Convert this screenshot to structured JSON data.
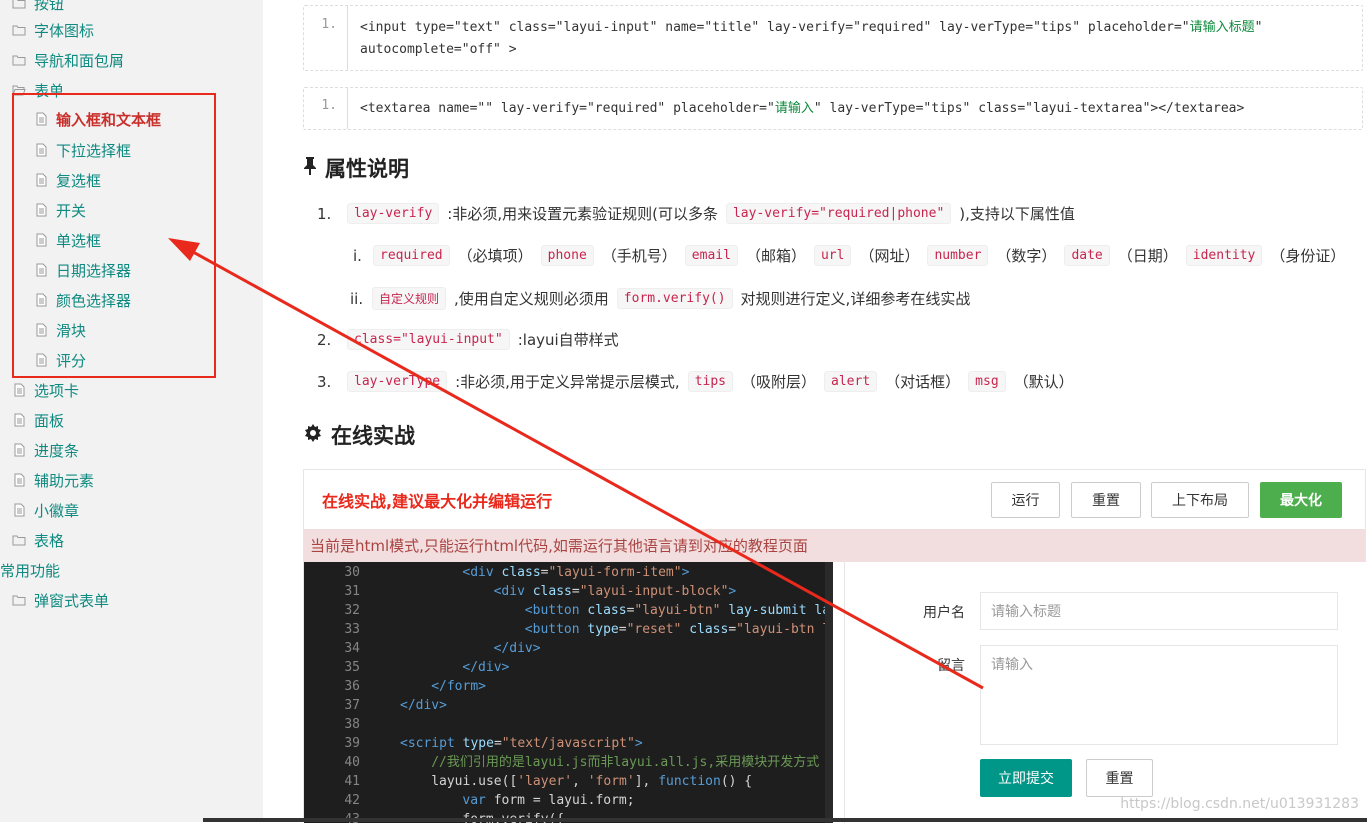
{
  "sidebar": {
    "top_partial_label": "按钮",
    "items": [
      {
        "label": "字体图标",
        "icon": "folder-icon"
      },
      {
        "label": "导航和面包屑",
        "icon": "folder-icon"
      },
      {
        "label": "表单",
        "icon": "folder-open-icon"
      },
      {
        "label": "输入框和文本框",
        "icon": "file-icon",
        "active": true
      },
      {
        "label": "下拉选择框",
        "icon": "file-icon"
      },
      {
        "label": "复选框",
        "icon": "file-icon"
      },
      {
        "label": "开关",
        "icon": "file-icon"
      },
      {
        "label": "单选框",
        "icon": "file-icon"
      },
      {
        "label": "日期选择器",
        "icon": "file-icon"
      },
      {
        "label": "颜色选择器",
        "icon": "file-icon"
      },
      {
        "label": "滑块",
        "icon": "file-icon"
      },
      {
        "label": "评分",
        "icon": "file-icon"
      },
      {
        "label": "选项卡",
        "icon": "file-icon"
      },
      {
        "label": "面板",
        "icon": "file-icon"
      },
      {
        "label": "进度条",
        "icon": "file-icon"
      },
      {
        "label": "辅助元素",
        "icon": "file-icon"
      },
      {
        "label": "小徽章",
        "icon": "file-icon"
      },
      {
        "label": "表格",
        "icon": "folder-icon"
      },
      {
        "label": "常用功能",
        "icon": "folder-icon"
      },
      {
        "label": "弹窗式表单",
        "icon": "folder-icon"
      }
    ]
  },
  "snippets": {
    "input": {
      "line_no": "1.",
      "line1_a": "<input type=\"text\" class=\"layui-input\" name=\"title\" lay-verify=\"required\" lay-verType=\"tips\" placeholder=\"",
      "line1_b": "请输入标题",
      "line1_c": "\"",
      "line2": "autocomplete=\"off\" >"
    },
    "textarea": {
      "line_no": "1.",
      "a": "<textarea name=\"\"  lay-verify=\"required\" placeholder=\"",
      "b": "请输入",
      "c": "\"  lay-verType=\"tips\" class=\"layui-textarea\"></textarea>"
    }
  },
  "attr_section": {
    "title": "属性说明",
    "icon": "pushpin-icon",
    "item1": {
      "num": "1.",
      "chip": "lay-verify",
      "text_a": ":非必须,用来设置元素验证规则(可以多条",
      "chip2": "lay-verify=\"required|phone\"",
      "text_b": "),支持以下属性值"
    },
    "sub_i": {
      "num": "i.",
      "pairs": [
        {
          "chip": "required",
          "text": "（必填项）"
        },
        {
          "chip": "phone",
          "text": "（手机号）"
        },
        {
          "chip": "email",
          "text": "（邮箱）"
        },
        {
          "chip": "url",
          "text": "（网址）"
        },
        {
          "chip": "number",
          "text": "（数字）"
        },
        {
          "chip": "date",
          "text": "（日期）"
        },
        {
          "chip": "identity",
          "text": "（身份证）"
        }
      ]
    },
    "sub_ii": {
      "num": "ii.",
      "chip": "自定义规则",
      "text_a": ",使用自定义规则必须用",
      "chip2": "form.verify()",
      "text_b": "对规则进行定义,详细参考在线实战"
    },
    "item2": {
      "num": "2.",
      "chip": "class=\"layui-input\"",
      "text": ":layui自带样式"
    },
    "item3": {
      "num": "3.",
      "chip": "lay-verType",
      "text_a": ":非必须,用于定义异常提示层模式,",
      "pairs": [
        {
          "chip": "tips",
          "text": "（吸附层）"
        },
        {
          "chip": "alert",
          "text": "（对话框）"
        },
        {
          "chip": "msg",
          "text": "（默认）"
        }
      ]
    }
  },
  "online_section": {
    "title": "在线实战",
    "icon": "gear-icon"
  },
  "demo": {
    "title": "在线实战,建议最大化并编辑运行",
    "buttons": {
      "run": "运行",
      "reset": "重置",
      "layout": "上下布局",
      "maximize": "最大化"
    },
    "notice": "当前是html模式,只能运行html代码,如需运行其他语言请到对应的教程页面",
    "code_lines": [
      {
        "no": "30",
        "indent": 8,
        "parts": [
          [
            "tag",
            "<div "
          ],
          [
            "attr",
            "class"
          ],
          [
            "plain",
            "="
          ],
          [
            "str",
            "\"layui-form-item\""
          ],
          [
            "tag",
            ">"
          ]
        ]
      },
      {
        "no": "31",
        "indent": 12,
        "parts": [
          [
            "tag",
            "<div "
          ],
          [
            "attr",
            "class"
          ],
          [
            "plain",
            "="
          ],
          [
            "str",
            "\"layui-input-block\""
          ],
          [
            "tag",
            ">"
          ]
        ]
      },
      {
        "no": "32",
        "indent": 16,
        "parts": [
          [
            "tag",
            "<button "
          ],
          [
            "attr",
            "class"
          ],
          [
            "plain",
            "="
          ],
          [
            "str",
            "\"layui-btn\""
          ],
          [
            "plain",
            " "
          ],
          [
            "attr",
            "lay-submit lay"
          ]
        ]
      },
      {
        "no": "33",
        "indent": 16,
        "parts": [
          [
            "tag",
            "<button "
          ],
          [
            "attr",
            "type"
          ],
          [
            "plain",
            "="
          ],
          [
            "str",
            "\"reset\""
          ],
          [
            "plain",
            " "
          ],
          [
            "attr",
            "class"
          ],
          [
            "plain",
            "="
          ],
          [
            "str",
            "\"layui-btn la"
          ]
        ]
      },
      {
        "no": "34",
        "indent": 12,
        "parts": [
          [
            "tag",
            "</div>"
          ]
        ]
      },
      {
        "no": "35",
        "indent": 8,
        "parts": [
          [
            "tag",
            "</div>"
          ]
        ]
      },
      {
        "no": "36",
        "indent": 4,
        "parts": [
          [
            "tag",
            "</form>"
          ]
        ]
      },
      {
        "no": "37",
        "indent": 0,
        "parts": [
          [
            "tag",
            "</div>"
          ]
        ]
      },
      {
        "no": "38",
        "indent": 0,
        "parts": []
      },
      {
        "no": "39",
        "indent": 0,
        "parts": [
          [
            "tag",
            "<script "
          ],
          [
            "attr",
            "type"
          ],
          [
            "plain",
            "="
          ],
          [
            "str",
            "\"text/javascript\""
          ],
          [
            "tag",
            ">"
          ]
        ]
      },
      {
        "no": "40",
        "indent": 4,
        "parts": [
          [
            "cmt",
            "//我们引用的是layui.js而非layui.all.js,采用模块开发方式"
          ]
        ]
      },
      {
        "no": "41",
        "indent": 4,
        "parts": [
          [
            "plain",
            "layui.use(["
          ],
          [
            "str",
            "'layer'"
          ],
          [
            "plain",
            ", "
          ],
          [
            "str",
            "'form'"
          ],
          [
            "plain",
            "], "
          ],
          [
            "kw",
            "function"
          ],
          [
            "plain",
            "() {"
          ]
        ]
      },
      {
        "no": "42",
        "indent": 8,
        "parts": [
          [
            "kw",
            "var"
          ],
          [
            "plain",
            " form = layui.form;"
          ]
        ]
      },
      {
        "no": "43",
        "indent": 8,
        "parts": [
          [
            "plain",
            "form.verify({"
          ]
        ]
      }
    ],
    "form": {
      "username_label": "用户名",
      "username_placeholder": "请输入标题",
      "message_label": "留言",
      "message_placeholder": "请输入",
      "submit": "立即提交",
      "reset": "重置"
    }
  },
  "watermark": "https://blog.csdn.net/u013931283",
  "colors": {
    "annotation_red": "#e8291c",
    "teal": "#009688",
    "green_btn": "#4cae4c"
  }
}
